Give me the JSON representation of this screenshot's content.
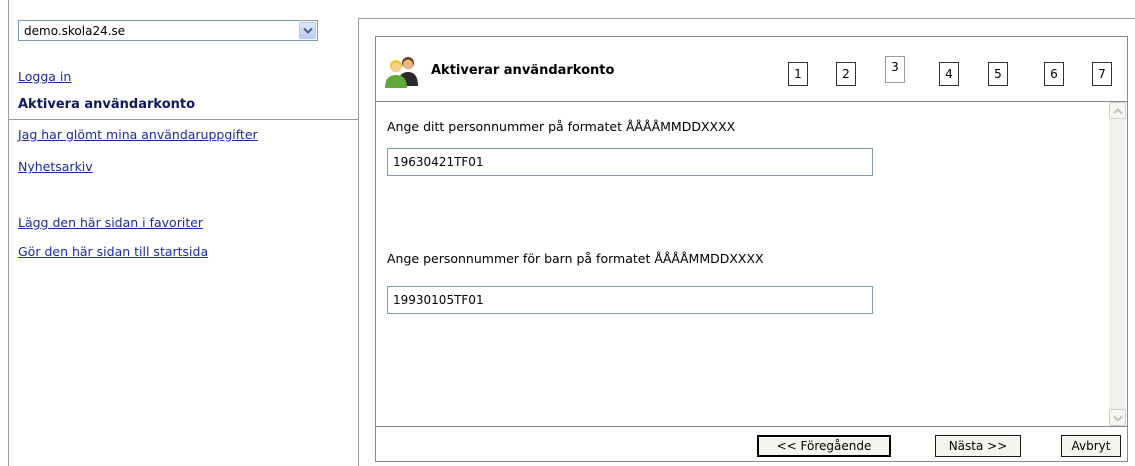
{
  "site_select": {
    "value": "demo.skola24.se"
  },
  "nav": {
    "login": "Logga in",
    "activate": "Aktivera användarkonto",
    "forgot": "Jag har glömt mina användaruppgifter",
    "news": "Nyhetsarkiv",
    "favorites": "Lägg den här sidan i favoriter",
    "startpage": "Gör den här sidan till startsida"
  },
  "wizard": {
    "title": "Aktiverar användarkonto",
    "steps": [
      "1",
      "2",
      "3",
      "4",
      "5",
      "6",
      "7"
    ],
    "current_step": 3,
    "personnummer_label": "Ange ditt personnummer på formatet ÅÅÅÅMMDDXXXX",
    "personnummer_value": "19630421TF01",
    "child_label": "Ange personnummer för barn på formatet ÅÅÅÅMMDDXXXX",
    "child_value": "19930105TF01",
    "prev_label": "<< Föregående",
    "next_label": "Nästa >>",
    "cancel_label": "Avbryt"
  },
  "colors": {
    "link": "#1a2ba6",
    "active_nav": "#0b1a63",
    "field_border": "#7f9db9"
  },
  "icons": {
    "dropdown": "chevron-down-icon",
    "wizard": "users-icon",
    "scroll_up": "arrow-up-icon",
    "scroll_down": "arrow-down-icon"
  }
}
